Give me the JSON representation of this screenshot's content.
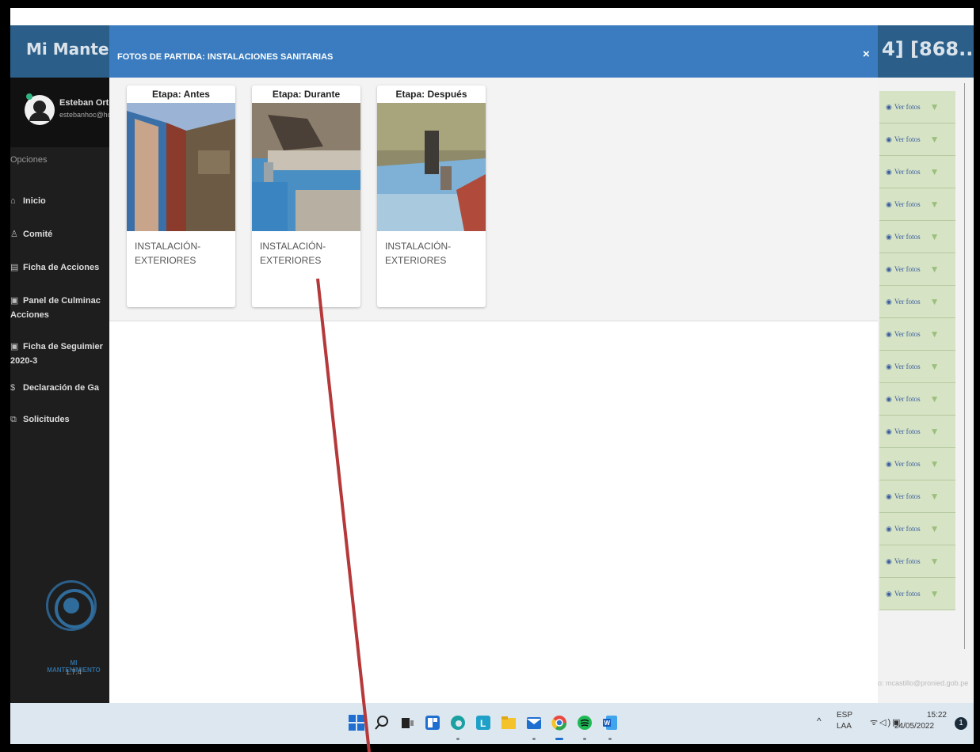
{
  "app": {
    "title": "Mi Mantenimie",
    "title_right": "4] [868...",
    "title_right_caret": "-"
  },
  "sidebar": {
    "user_name": "Esteban Orteg",
    "user_email": "estebanhoc@ho",
    "options_label": "Opciones",
    "items": [
      {
        "icon": "home-icon",
        "glyph": "⌂",
        "label": "Inicio"
      },
      {
        "icon": "users-icon",
        "glyph": "♙",
        "label": "Comité"
      },
      {
        "icon": "list-icon",
        "glyph": "▤",
        "label": "Ficha de Acciones"
      },
      {
        "icon": "image-icon",
        "glyph": "▣",
        "label": "Panel de Culminac",
        "label2": "Acciones"
      },
      {
        "icon": "image-icon",
        "glyph": "▣",
        "label": "Ficha de Seguimier",
        "label2": "2020-3"
      },
      {
        "icon": "dollar-icon",
        "glyph": "$",
        "label": "Declaración de Ga"
      },
      {
        "icon": "copy-icon",
        "glyph": "⧉",
        "label": "Solicitudes"
      }
    ],
    "logo_text": "MI MANTENIMIENTO",
    "version": "1.7.4"
  },
  "modal": {
    "title": "FOTOS DE PARTIDA: INSTALACIONES SANITARIAS",
    "close_label": "×",
    "photos": [
      {
        "stage": "Etapa: Antes",
        "desc1": "INSTALACIÓN-",
        "desc2": "EXTERIORES"
      },
      {
        "stage": "Etapa: Durante",
        "desc1": "INSTALACIÓN-",
        "desc2": "EXTERIORES"
      },
      {
        "stage": "Etapa: Después",
        "desc1": "INSTALACIÓN-",
        "desc2": "EXTERIORES"
      }
    ]
  },
  "right_list": {
    "row_label": "Ver fotos",
    "row_count": 16
  },
  "footer": {
    "contact": "o: mcastillo@pronied.gob.pe"
  },
  "taskbar": {
    "lang1": "ESP",
    "lang2": "LAA",
    "time": "15:22",
    "date": "24/05/2022",
    "notifications": "1"
  },
  "colors": {
    "header": "#2b5f8a",
    "modal_header": "#3a7cbf",
    "sidebar": "#1e1e1e",
    "annotation": "#b5393a"
  }
}
